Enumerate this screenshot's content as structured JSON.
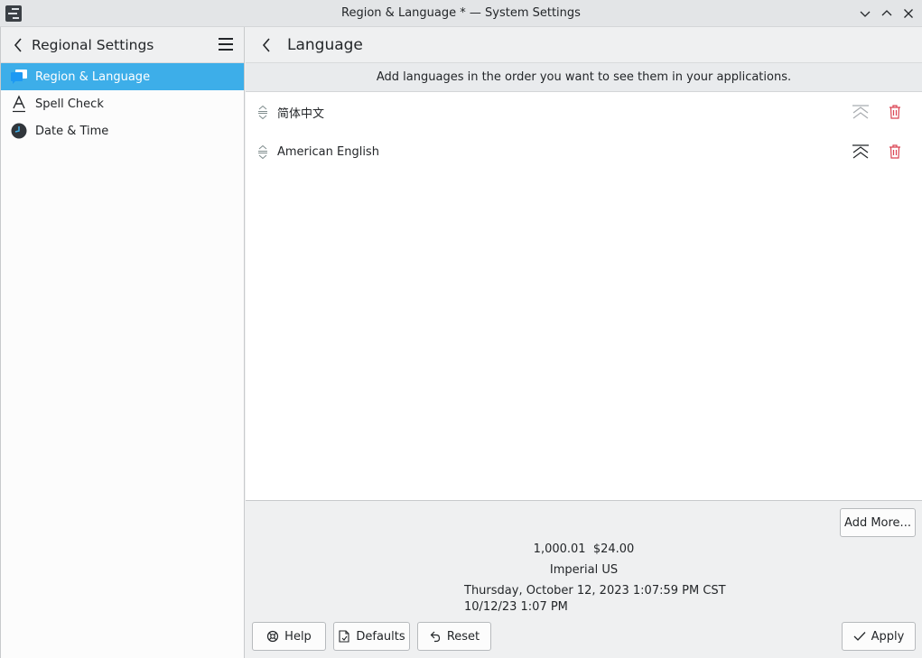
{
  "window": {
    "title": "Region & Language * — System Settings",
    "icon": "system-settings-icon"
  },
  "sidebar": {
    "title": "Regional Settings",
    "items": [
      {
        "label": "Region & Language",
        "icon": "region-language-icon",
        "active": true
      },
      {
        "label": "Spell Check",
        "icon": "spell-check-icon",
        "active": false
      },
      {
        "label": "Date & Time",
        "icon": "clock-icon",
        "active": false
      }
    ]
  },
  "main": {
    "title": "Language",
    "info": "Add languages in the order you want to see them in your applications.",
    "languages": [
      {
        "name": "简体中文"
      },
      {
        "name": "American English"
      }
    ],
    "add_more_label": "Add More..."
  },
  "preview": {
    "numbers": "1,000.01  $24.00",
    "measurement": "Imperial US",
    "long_date": "Thursday, October 12, 2023 1:07:59 PM CST",
    "short_date": "10/12/23 1:07 PM"
  },
  "footer": {
    "help_label": "Help",
    "defaults_label": "Defaults",
    "reset_label": "Reset",
    "apply_label": "Apply"
  },
  "colors": {
    "accent": "#3daee9",
    "delete": "#da4453"
  }
}
